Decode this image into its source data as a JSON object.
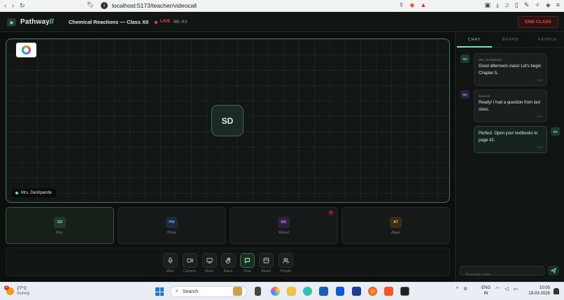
{
  "browser": {
    "url": "localhost:5173/teacher/videocall"
  },
  "header": {
    "brand": "Pathway",
    "brand_accent": "//",
    "class_title": "Chemical Reactions — Class XII",
    "live_label": "LIVE",
    "live_time": "08:03",
    "end_button": "END CLASS"
  },
  "stage": {
    "speaker_initials": "SD",
    "speaker_name": "Mrs. Deshpande"
  },
  "participants": [
    {
      "initials": "SD",
      "name": "Mrs.",
      "bg": "#1f3a2e",
      "fg": "#7ee2a8",
      "muted": false,
      "active": true
    },
    {
      "initials": "PM",
      "name": "Priya",
      "bg": "#1c2a40",
      "fg": "#7aa8f0",
      "muted": false,
      "active": false
    },
    {
      "initials": "RK",
      "name": "Rahul",
      "bg": "#2e2140",
      "fg": "#b590f0",
      "muted": true,
      "active": false
    },
    {
      "initials": "AT",
      "name": "Arjun",
      "bg": "#3a2c14",
      "fg": "#e8b35a",
      "muted": false,
      "active": false
    }
  ],
  "mute_glyph": "✕",
  "controls": {
    "mute": "Mute",
    "camera": "Camera",
    "share": "Share",
    "raise": "Raise",
    "chat": "Chat",
    "board": "Board",
    "people": "People"
  },
  "side": {
    "tabs": [
      "CHAT",
      "BOARD",
      "PEOPLE"
    ],
    "messages": [
      {
        "initials": "SD",
        "sender": "Mrs. Deshpande",
        "text": "Good afternoon class! Let's begin Chapter 5.",
        "time": "2:31"
      },
      {
        "initials": "RK",
        "sender": "Rahul K.",
        "text": "Ready! I had a question from last class.",
        "time": "2:31"
      },
      {
        "initials": "SD",
        "sender": "",
        "text": "Perfect. Open your textbooks to page 42.",
        "time": "2:32"
      }
    ],
    "composer_placeholder": "Message class..."
  },
  "taskbar": {
    "temperature": "27°C",
    "condition": "Sunny",
    "weather_badge": "2",
    "search_label": "Search",
    "lang_line1": "ENG",
    "lang_line2": "IN",
    "time": "10:05",
    "date": "19-03-2026"
  }
}
